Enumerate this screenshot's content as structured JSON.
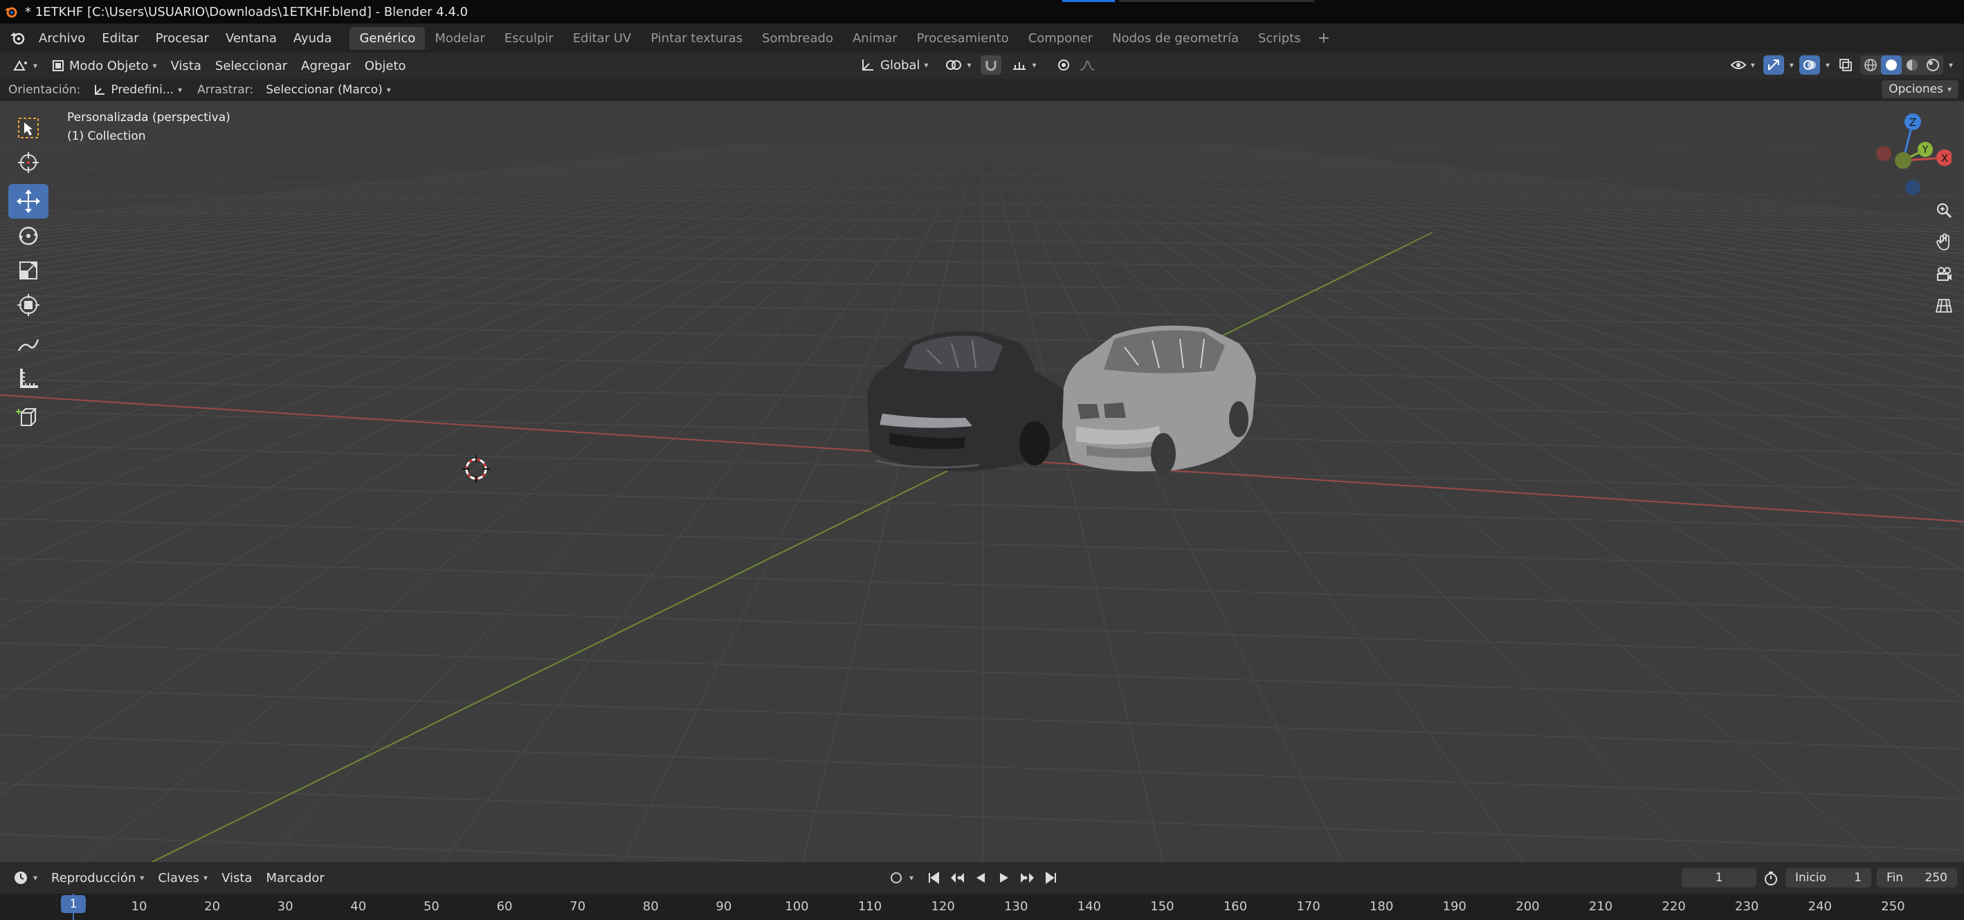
{
  "window": {
    "title": "* 1ETKHF [C:\\Users\\USUARIO\\Downloads\\1ETKHF.blend] - Blender 4.4.0"
  },
  "menu": [
    "Archivo",
    "Editar",
    "Procesar",
    "Ventana",
    "Ayuda"
  ],
  "workspaces": [
    "Genérico",
    "Modelar",
    "Esculpir",
    "Editar UV",
    "Pintar texturas",
    "Sombreado",
    "Animar",
    "Procesamiento",
    "Componer",
    "Nodos de geometría",
    "Scripts"
  ],
  "active_workspace": "Genérico",
  "header": {
    "mode": "Modo Objeto",
    "menus": [
      "Vista",
      "Seleccionar",
      "Agregar",
      "Objeto"
    ],
    "transform_orientation": "Global"
  },
  "tool_settings": {
    "orientation_label": "Orientación:",
    "orientation_value": "Predefini...",
    "drag_label": "Arrastrar:",
    "drag_value": "Seleccionar (Marco)",
    "options": "Opciones"
  },
  "viewport": {
    "view_name": "Personalizada (perspectiva)",
    "collection": "(1) Collection",
    "axis_labels": {
      "x": "X",
      "y": "Y",
      "z": "Z"
    }
  },
  "timeline": {
    "playback": "Reproducción",
    "keys": "Claves",
    "view": "Vista",
    "marker": "Marcador",
    "current_frame": "1",
    "start_label": "Inicio",
    "start_value": "1",
    "end_label": "Fin",
    "end_value": "250",
    "ruler_current": "1",
    "ruler_ticks": [
      "10",
      "20",
      "30",
      "40",
      "50",
      "60",
      "70",
      "80",
      "90",
      "100",
      "110",
      "120",
      "130",
      "140",
      "150",
      "160",
      "170",
      "180",
      "190",
      "200",
      "210",
      "220",
      "230",
      "240",
      "250"
    ]
  },
  "colors": {
    "accent": "#4772b3",
    "x_axis": "#c84a4a",
    "y_axis": "#8ab33c",
    "z_axis": "#3b7fd9"
  }
}
